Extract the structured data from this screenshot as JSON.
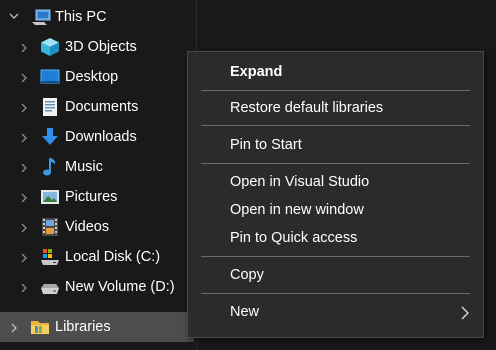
{
  "nav": {
    "this_pc": "This PC",
    "items": [
      {
        "label": "3D Objects",
        "icon": "3d-objects-icon"
      },
      {
        "label": "Desktop",
        "icon": "desktop-icon"
      },
      {
        "label": "Documents",
        "icon": "documents-icon"
      },
      {
        "label": "Downloads",
        "icon": "downloads-icon"
      },
      {
        "label": "Music",
        "icon": "music-icon"
      },
      {
        "label": "Pictures",
        "icon": "pictures-icon"
      },
      {
        "label": "Videos",
        "icon": "videos-icon"
      },
      {
        "label": "Local Disk (C:)",
        "icon": "local-disk-icon"
      },
      {
        "label": "New Volume (D:)",
        "icon": "drive-icon"
      }
    ],
    "libraries": "Libraries"
  },
  "context_menu": {
    "expand": "Expand",
    "restore": "Restore default libraries",
    "pin_start": "Pin to Start",
    "open_vs": "Open in Visual Studio",
    "open_new_window": "Open in new window",
    "pin_quick": "Pin to Quick access",
    "copy": "Copy",
    "new": "New"
  },
  "colors": {
    "background": "#191919",
    "menu_background": "#2b2b2b",
    "selected_row": "#4d4d4d",
    "separator": "#6b6b6b"
  }
}
